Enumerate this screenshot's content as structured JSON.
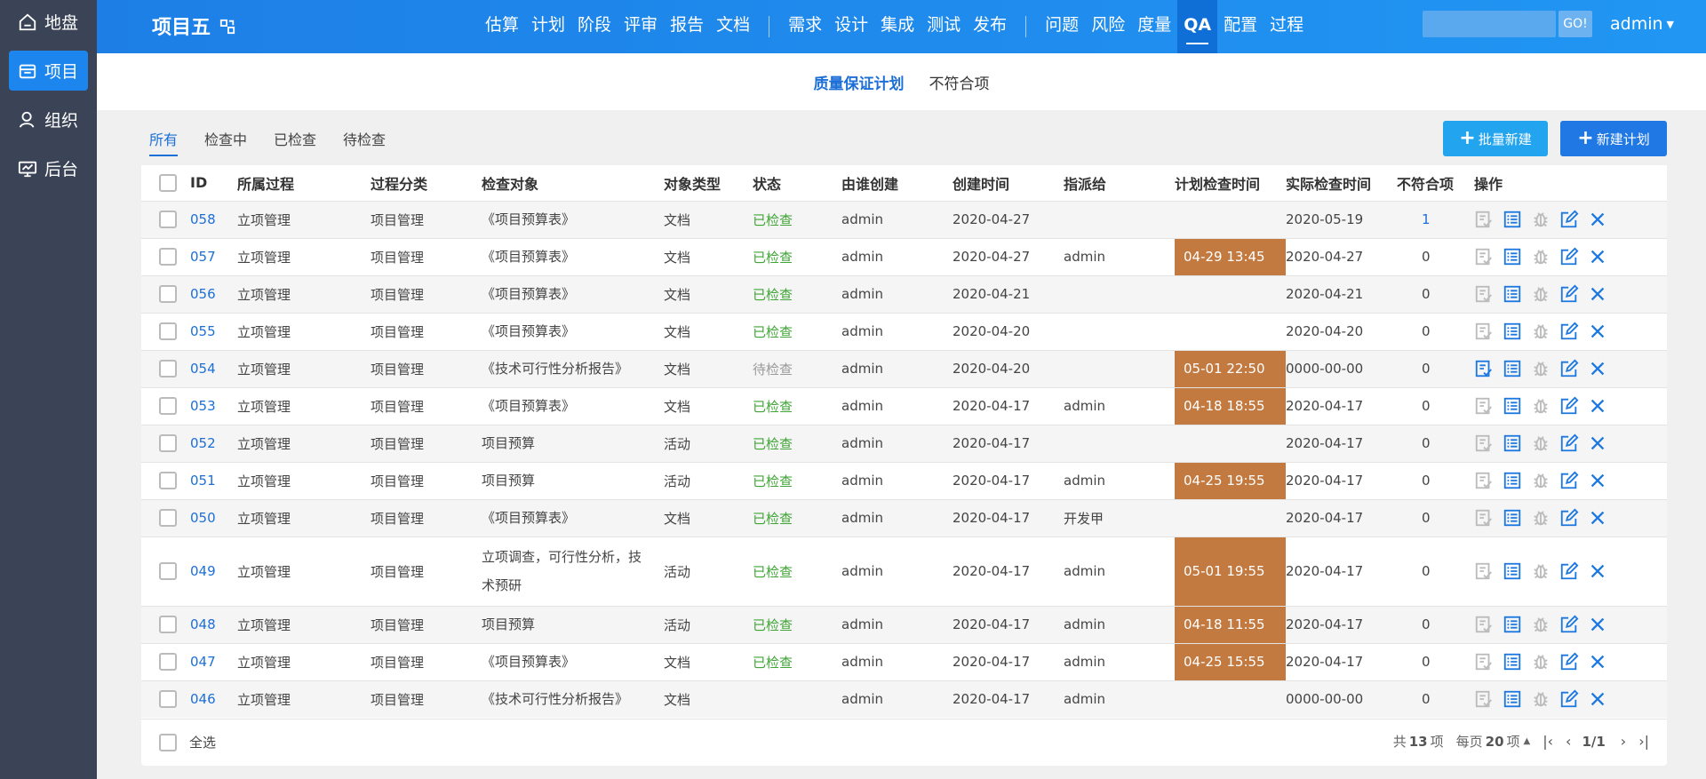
{
  "sidebar": {
    "items": [
      {
        "label": "地盘",
        "icon": "home-icon"
      },
      {
        "label": "项目",
        "icon": "project-icon"
      },
      {
        "label": "组织",
        "icon": "user-icon"
      },
      {
        "label": "后台",
        "icon": "monitor-icon"
      }
    ],
    "active_index": 1
  },
  "header": {
    "project_name": "项目五",
    "nav_group1": [
      "估算",
      "计划",
      "阶段",
      "评审",
      "报告",
      "文档"
    ],
    "nav_group2": [
      "需求",
      "设计",
      "集成",
      "测试",
      "发布"
    ],
    "nav_group3": [
      "问题",
      "风险",
      "度量",
      "QA",
      "配置",
      "过程"
    ],
    "active_nav": "QA",
    "search_placeholder": "",
    "search_button": "GO!",
    "user": "admin"
  },
  "subnav": {
    "tabs": [
      "质量保证计划",
      "不符合项"
    ],
    "active": "质量保证计划"
  },
  "filter": {
    "tabs": [
      "所有",
      "检查中",
      "已检查",
      "待检查"
    ],
    "active": "所有"
  },
  "actions": {
    "batch_new": "批量新建",
    "new_plan": "新建计划"
  },
  "colors": {
    "primary": "#1c6fd6",
    "planned_highlight": "#c27a41",
    "status_done": "#3fa535",
    "sidebar_bg": "#3b4456"
  },
  "table": {
    "columns": [
      "ID",
      "所属过程",
      "过程分类",
      "检查对象",
      "对象类型",
      "状态",
      "由谁创建",
      "创建时间",
      "指派给",
      "计划检查时间",
      "实际检查时间",
      "不符合项",
      "操作"
    ],
    "rows": [
      {
        "id": "058",
        "process": "立项管理",
        "category": "项目管理",
        "object": "《项目预算表》",
        "type": "文档",
        "status": "已检查",
        "creator": "admin",
        "created": "2020-04-27",
        "assignee": "",
        "planned": "",
        "actual": "2020-05-19",
        "nc": "1"
      },
      {
        "id": "057",
        "process": "立项管理",
        "category": "项目管理",
        "object": "《项目预算表》",
        "type": "文档",
        "status": "已检查",
        "creator": "admin",
        "created": "2020-04-27",
        "assignee": "admin",
        "planned": "04-29 13:45",
        "actual": "2020-04-27",
        "nc": "0"
      },
      {
        "id": "056",
        "process": "立项管理",
        "category": "项目管理",
        "object": "《项目预算表》",
        "type": "文档",
        "status": "已检查",
        "creator": "admin",
        "created": "2020-04-21",
        "assignee": "",
        "planned": "",
        "actual": "2020-04-21",
        "nc": "0"
      },
      {
        "id": "055",
        "process": "立项管理",
        "category": "项目管理",
        "object": "《项目预算表》",
        "type": "文档",
        "status": "已检查",
        "creator": "admin",
        "created": "2020-04-20",
        "assignee": "",
        "planned": "",
        "actual": "2020-04-20",
        "nc": "0"
      },
      {
        "id": "054",
        "process": "立项管理",
        "category": "项目管理",
        "object": "《技术可行性分析报告》",
        "type": "文档",
        "status": "待检查",
        "creator": "admin",
        "created": "2020-04-20",
        "assignee": "",
        "planned": "05-01 22:50",
        "actual": "0000-00-00",
        "nc": "0"
      },
      {
        "id": "053",
        "process": "立项管理",
        "category": "项目管理",
        "object": "《项目预算表》",
        "type": "文档",
        "status": "已检查",
        "creator": "admin",
        "created": "2020-04-17",
        "assignee": "admin",
        "planned": "04-18 18:55",
        "actual": "2020-04-17",
        "nc": "0"
      },
      {
        "id": "052",
        "process": "立项管理",
        "category": "项目管理",
        "object": "项目预算",
        "type": "活动",
        "status": "已检查",
        "creator": "admin",
        "created": "2020-04-17",
        "assignee": "",
        "planned": "",
        "actual": "2020-04-17",
        "nc": "0"
      },
      {
        "id": "051",
        "process": "立项管理",
        "category": "项目管理",
        "object": "项目预算",
        "type": "活动",
        "status": "已检查",
        "creator": "admin",
        "created": "2020-04-17",
        "assignee": "admin",
        "planned": "04-25 19:55",
        "actual": "2020-04-17",
        "nc": "0"
      },
      {
        "id": "050",
        "process": "立项管理",
        "category": "项目管理",
        "object": "《项目预算表》",
        "type": "文档",
        "status": "已检查",
        "creator": "admin",
        "created": "2020-04-17",
        "assignee": "开发甲",
        "planned": "",
        "actual": "2020-04-17",
        "nc": "0"
      },
      {
        "id": "049",
        "process": "立项管理",
        "category": "项目管理",
        "object": "立项调查，可行性分析，技术预研",
        "type": "活动",
        "status": "已检查",
        "creator": "admin",
        "created": "2020-04-17",
        "assignee": "admin",
        "planned": "05-01 19:55",
        "actual": "2020-04-17",
        "nc": "0"
      },
      {
        "id": "048",
        "process": "立项管理",
        "category": "项目管理",
        "object": "项目预算",
        "type": "活动",
        "status": "已检查",
        "creator": "admin",
        "created": "2020-04-17",
        "assignee": "admin",
        "planned": "04-18 11:55",
        "actual": "2020-04-17",
        "nc": "0"
      },
      {
        "id": "047",
        "process": "立项管理",
        "category": "项目管理",
        "object": "《项目预算表》",
        "type": "文档",
        "status": "已检查",
        "creator": "admin",
        "created": "2020-04-17",
        "assignee": "admin",
        "planned": "04-25 15:55",
        "actual": "2020-04-17",
        "nc": "0"
      },
      {
        "id": "046",
        "process": "立项管理",
        "category": "项目管理",
        "object": "《技术可行性分析报告》",
        "type": "文档",
        "status": "",
        "creator": "admin",
        "created": "2020-04-17",
        "assignee": "admin",
        "planned": "",
        "actual": "0000-00-00",
        "nc": "0"
      }
    ]
  },
  "footer": {
    "select_all": "全选",
    "total_prefix": "共",
    "total": "13",
    "total_suffix": "项",
    "per_page_prefix": "每页",
    "per_page": "20",
    "per_page_suffix": "项",
    "page": "1/1"
  }
}
